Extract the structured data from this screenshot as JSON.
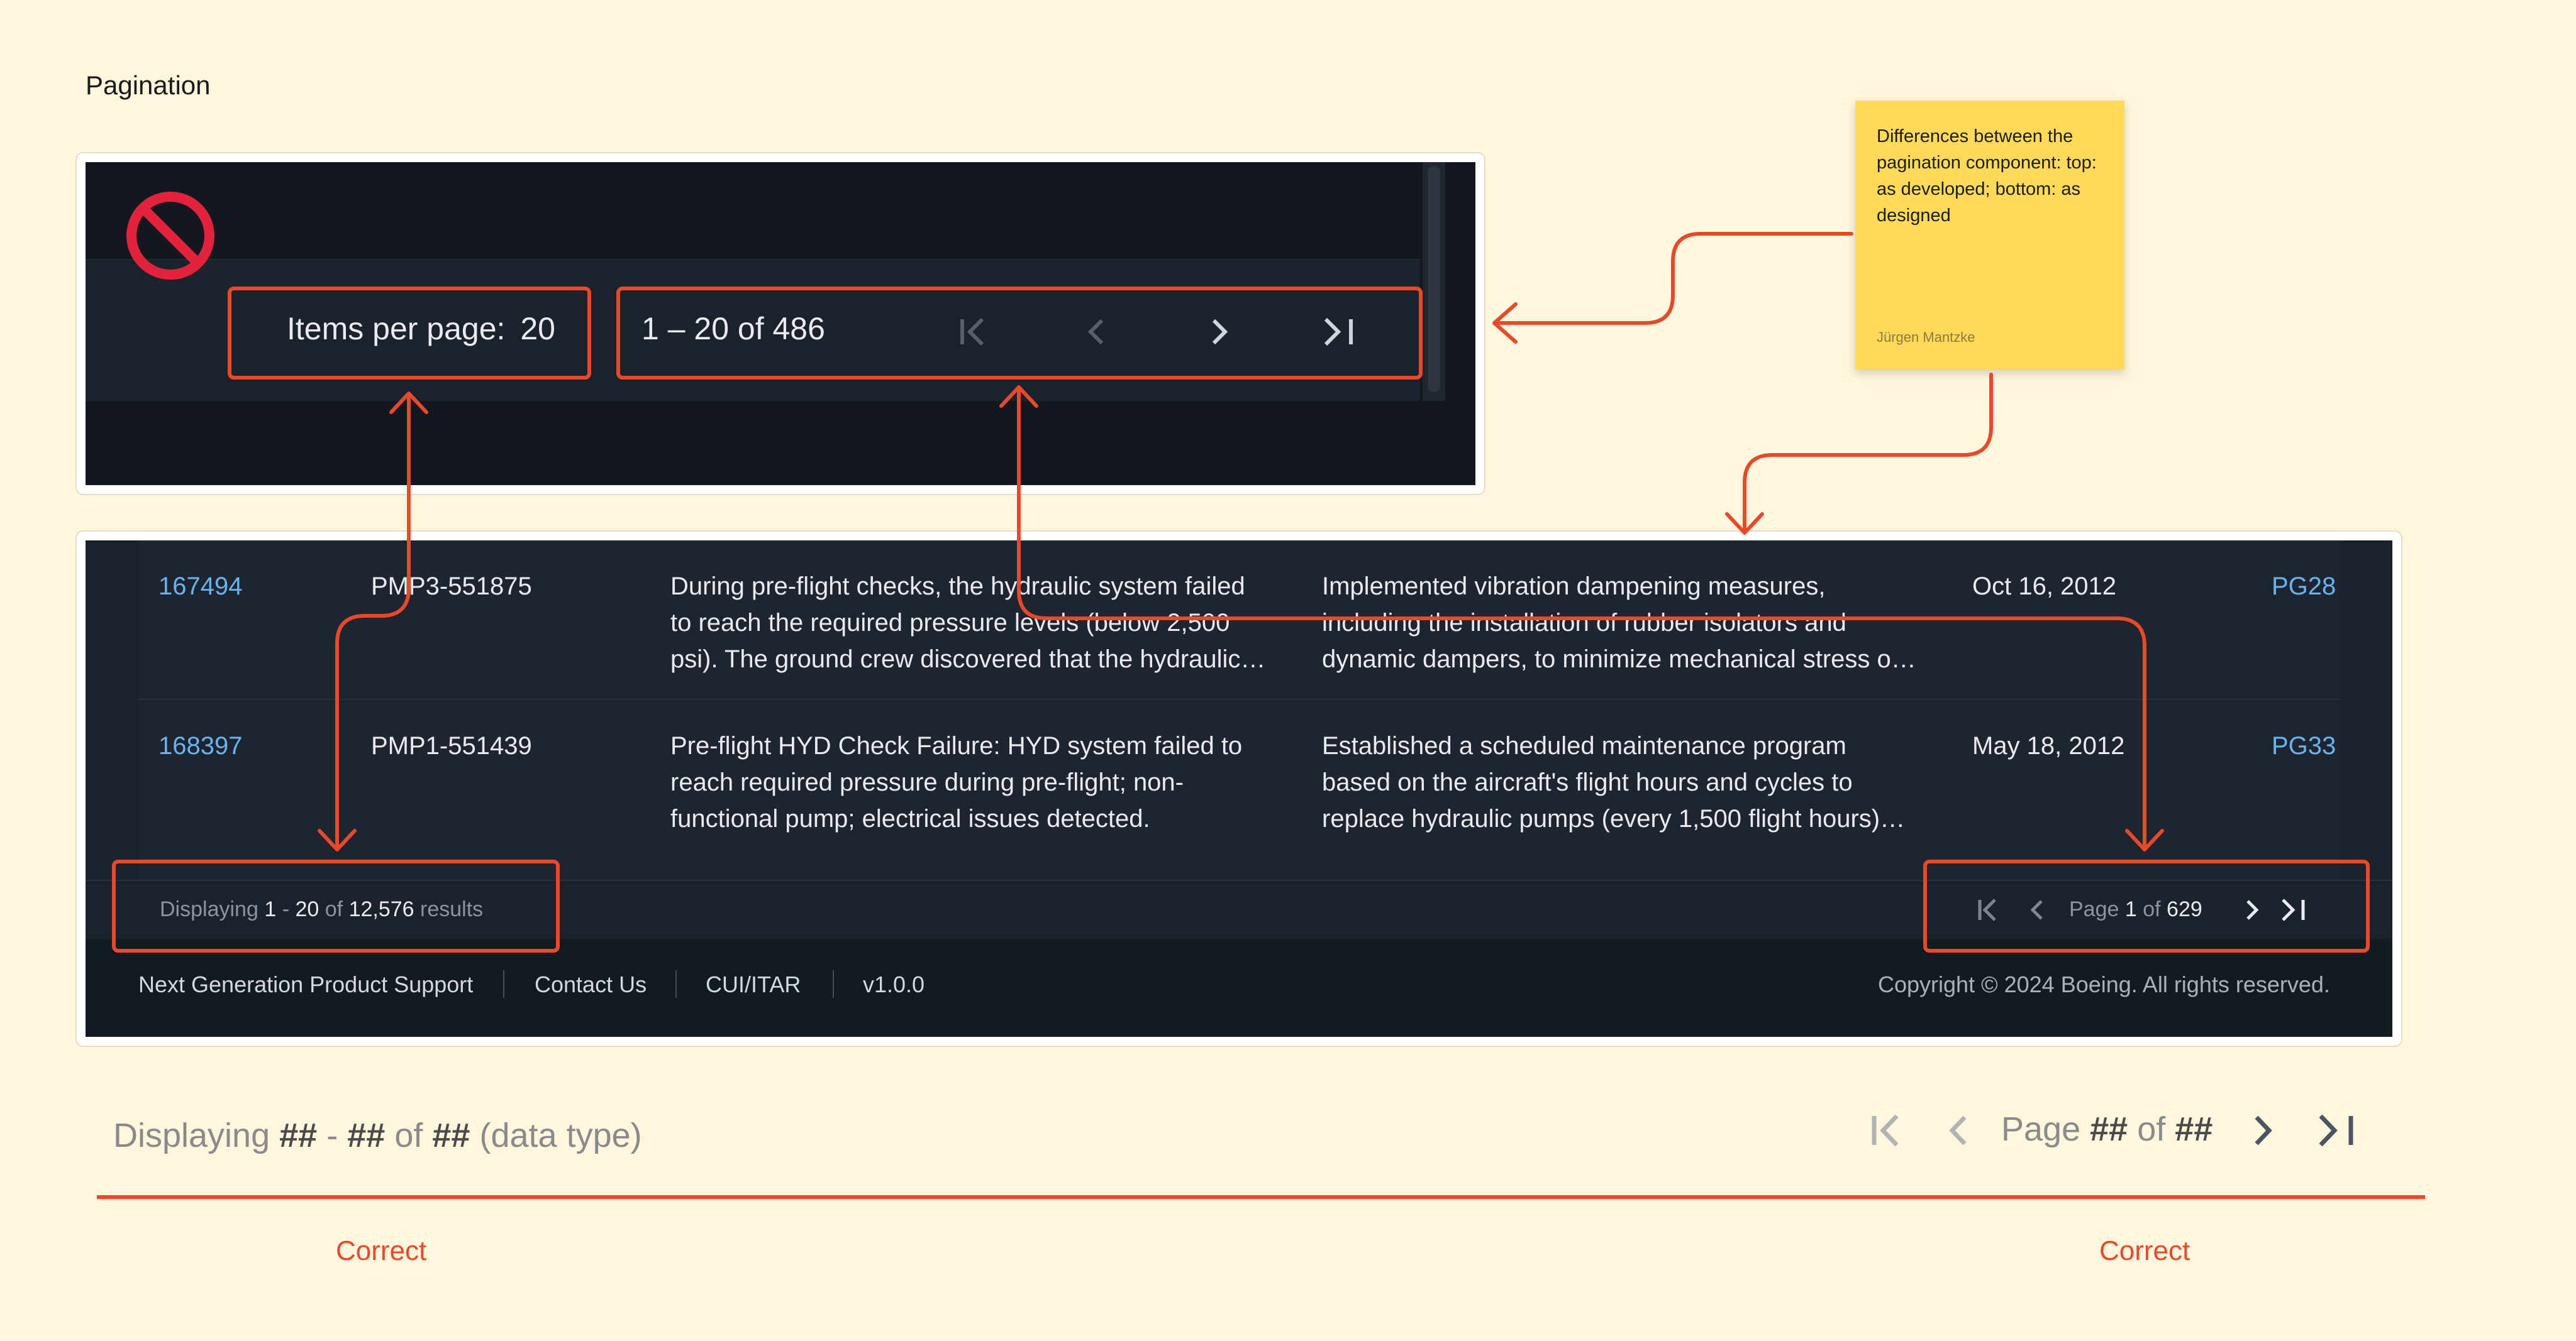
{
  "page": {
    "title": "Pagination"
  },
  "developed": {
    "items_per_page_label": "Items per page:",
    "items_per_page_value": "20",
    "range_label": "1 – 20 of 486"
  },
  "designed": {
    "rows": [
      {
        "id": "167494",
        "part": "PMP3-551875",
        "desc": [
          "During pre-flight checks, the hydraulic system failed",
          "to reach the required pressure levels (below 2,500",
          "psi). The ground crew discovered that the hydraulic…"
        ],
        "action": [
          "Implemented vibration dampening measures,",
          "including the installation of rubber isolators and",
          "dynamic dampers, to minimize mechanical stress o…"
        ],
        "date": "Oct 16, 2012",
        "code": "PG28"
      },
      {
        "id": "168397",
        "part": "PMP1-551439",
        "desc": [
          "Pre-flight HYD Check Failure: HYD system failed to",
          "reach required pressure during pre-flight; non-",
          "functional pump; electrical issues detected."
        ],
        "action": [
          "Established a scheduled maintenance program",
          "based on the aircraft's flight hours and cycles to",
          "replace hydraulic pumps (every 1,500 flight hours)…"
        ],
        "date": "May 18, 2012",
        "code": "PG33"
      }
    ],
    "displaying": {
      "label": "Displaying",
      "start": "1",
      "dash": "-",
      "end": "20",
      "of": "of",
      "total": "12,576",
      "suffix": "results"
    },
    "pager": {
      "page_label": "Page",
      "current": "1",
      "of": "of",
      "total": "629"
    },
    "footer": {
      "links": [
        "Next Generation Product Support",
        "Contact Us",
        "CUI/ITAR",
        "v1.0.0"
      ],
      "copyright": "Copyright ©  2024  Boeing. All rights reserved."
    }
  },
  "note": {
    "text": "Differences between the pagination component: top: as developed; bottom: as designed",
    "author": "Jürgen Mantzke"
  },
  "spec": {
    "displaying": "Displaying",
    "hash": "##",
    "dash": "-",
    "of": "of",
    "type": "(data type)",
    "page_label": "Page",
    "correct_left": "Correct",
    "correct_right": "Correct"
  },
  "colors": {
    "background": "#fff6dd",
    "accent_red": "#e8492a",
    "link_blue": "#66b4f0",
    "sticky_yellow": "#ffd95a"
  },
  "icons": [
    "prohibited-icon",
    "first-page-icon",
    "prev-page-icon",
    "next-page-icon",
    "last-page-icon"
  ]
}
